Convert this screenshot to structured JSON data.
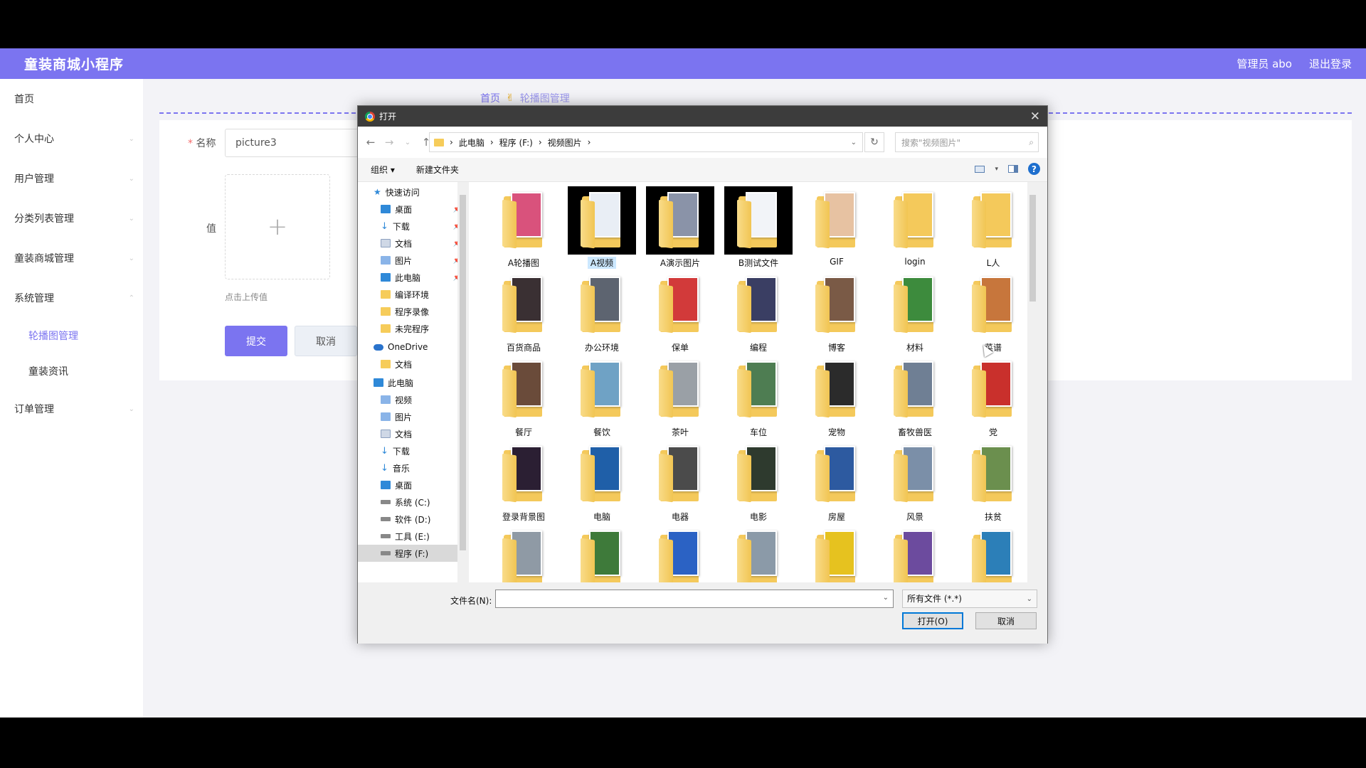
{
  "app": {
    "title": "童装商城小程序",
    "admin_label": "管理员 abo",
    "logout_label": "退出登录"
  },
  "sidebar": {
    "items": [
      {
        "label": "首页",
        "arrow": ""
      },
      {
        "label": "个人中心",
        "arrow": "⌄"
      },
      {
        "label": "用户管理",
        "arrow": "⌄"
      },
      {
        "label": "分类列表管理",
        "arrow": "⌄"
      },
      {
        "label": "童装商城管理",
        "arrow": "⌄"
      },
      {
        "label": "系统管理",
        "arrow": "⌃"
      }
    ],
    "subitems": [
      {
        "label": "轮播图管理"
      },
      {
        "label": "童装资讯"
      }
    ],
    "last": {
      "label": "订单管理",
      "arrow": "⌄"
    }
  },
  "breadcrumb": {
    "home": "首页",
    "icon": "✌",
    "current": "轮播图管理"
  },
  "form": {
    "name_label": "名称",
    "name_value": "picture3",
    "value_label": "值",
    "upload_plus": "+",
    "upload_hint": "点击上传值",
    "submit_label": "提交",
    "cancel_label": "取消"
  },
  "dialog": {
    "title": "打开",
    "close": "✕",
    "nav": {
      "back": "←",
      "forward": "→",
      "recent": "⌄",
      "up": "↑"
    },
    "path": [
      "此电脑",
      "程序 (F:)",
      "视频图片"
    ],
    "sep": "›",
    "refresh": "↻",
    "search_placeholder": "搜索\"视频图片\"",
    "search_icon": "⌕",
    "organize_label": "组织 ▾",
    "new_folder_label": "新建文件夹",
    "help_label": "?",
    "nav_pane": [
      {
        "label": "快速访问",
        "icon": "star",
        "top": true
      },
      {
        "label": "桌面",
        "icon": "blue",
        "pin": true
      },
      {
        "label": "下载",
        "icon": "dl",
        "pin": true
      },
      {
        "label": "文档",
        "icon": "doc",
        "pin": true
      },
      {
        "label": "图片",
        "icon": "pic",
        "pin": true
      },
      {
        "label": "此电脑",
        "icon": "blue",
        "pin": true
      },
      {
        "label": "编译环境",
        "icon": "fold"
      },
      {
        "label": "程序录像",
        "icon": "fold"
      },
      {
        "label": "未完程序",
        "icon": "fold"
      },
      {
        "label": "OneDrive",
        "icon": "cloud",
        "top": true
      },
      {
        "label": "文档",
        "icon": "fold"
      },
      {
        "label": "此电脑",
        "icon": "blue",
        "top": true
      },
      {
        "label": "视频",
        "icon": "pic"
      },
      {
        "label": "图片",
        "icon": "pic"
      },
      {
        "label": "文档",
        "icon": "doc"
      },
      {
        "label": "下载",
        "icon": "dl"
      },
      {
        "label": "音乐",
        "icon": "dl"
      },
      {
        "label": "桌面",
        "icon": "blue"
      },
      {
        "label": "系统 (C:)",
        "icon": "disk"
      },
      {
        "label": "软件 (D:)",
        "icon": "disk"
      },
      {
        "label": "工具 (E:)",
        "icon": "disk"
      },
      {
        "label": "程序 (F:)",
        "icon": "disk",
        "sel": true
      }
    ],
    "files": [
      {
        "name": "A轮播图",
        "color": "#d9527c"
      },
      {
        "name": "A视频",
        "color": "#e9eef5",
        "hl": true,
        "sel": true
      },
      {
        "name": "A演示图片",
        "color": "#8a93a8",
        "hl": true
      },
      {
        "name": "B测试文件",
        "color": "#f2f4f8",
        "hl": true
      },
      {
        "name": "GIF",
        "color": "#e7c2a2"
      },
      {
        "name": "login",
        "color": "#f4c95b"
      },
      {
        "name": "L人",
        "color": "#f4c95b"
      },
      {
        "name": "百货商品",
        "color": "#3a3033"
      },
      {
        "name": "办公环境",
        "color": "#5d6470"
      },
      {
        "name": "保单",
        "color": "#d23a3a"
      },
      {
        "name": "编程",
        "color": "#3a3e63"
      },
      {
        "name": "博客",
        "color": "#7a5a46"
      },
      {
        "name": "材料",
        "color": "#3d8b3d"
      },
      {
        "name": "菜谱",
        "color": "#c7763c"
      },
      {
        "name": "餐厅",
        "color": "#6a4b3a"
      },
      {
        "name": "餐饮",
        "color": "#6fa2c5"
      },
      {
        "name": "茶叶",
        "color": "#9aa0a6"
      },
      {
        "name": "车位",
        "color": "#4e7d52"
      },
      {
        "name": "宠物",
        "color": "#2b2b2b"
      },
      {
        "name": "畜牧兽医",
        "color": "#6f7f94"
      },
      {
        "name": "党",
        "color": "#c9302c"
      },
      {
        "name": "登录背景图",
        "color": "#2b1f33"
      },
      {
        "name": "电脑",
        "color": "#1f5fa8"
      },
      {
        "name": "电器",
        "color": "#4b4b4b"
      },
      {
        "name": "电影",
        "color": "#2e3a2e"
      },
      {
        "name": "房屋",
        "color": "#2d5aa0"
      },
      {
        "name": "风景",
        "color": "#7b8fa8"
      },
      {
        "name": "扶贫",
        "color": "#6b8f4e"
      },
      {
        "name": "",
        "color": "#8f9aa5"
      },
      {
        "name": "",
        "color": "#3e7a3a"
      },
      {
        "name": "",
        "color": "#2b62c4"
      },
      {
        "name": "",
        "color": "#8b9aa8"
      },
      {
        "name": "",
        "color": "#e6c21f"
      },
      {
        "name": "",
        "color": "#6c4b9e"
      },
      {
        "name": "",
        "color": "#2c7fb8"
      }
    ],
    "filename_label": "文件名(N):",
    "filename_value": "",
    "filetype_value": "所有文件 (*.*)",
    "open_label": "打开(O)",
    "cancel_label": "取消"
  }
}
